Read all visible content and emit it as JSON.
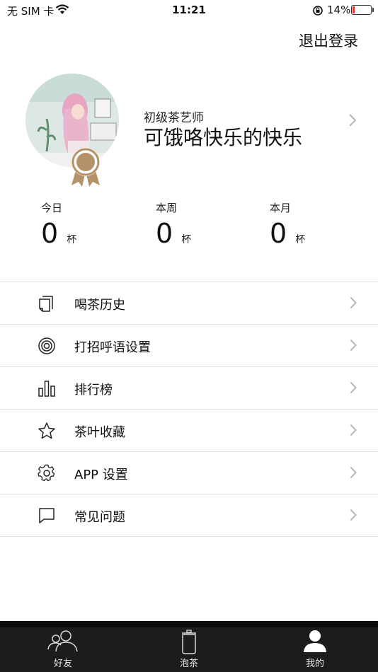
{
  "status_bar": {
    "carrier": "无 SIM 卡",
    "time": "11:21",
    "battery_percent": "14%",
    "battery_level": 0.14,
    "battery_color": "#e8322f"
  },
  "header": {
    "logout_label": "退出登录"
  },
  "profile": {
    "level": "初级茶艺师",
    "nickname": "可饿咯快乐的快乐",
    "medal_color": "#b4926a"
  },
  "stats": [
    {
      "label": "今日",
      "value": "0",
      "unit": "杯"
    },
    {
      "label": "本周",
      "value": "0",
      "unit": "杯"
    },
    {
      "label": "本月",
      "value": "0",
      "unit": "杯"
    }
  ],
  "menu": [
    {
      "label": "喝茶历史",
      "icon": "history-icon"
    },
    {
      "label": "打招呼语设置",
      "icon": "greeting-icon"
    },
    {
      "label": "排行榜",
      "icon": "ranking-icon"
    },
    {
      "label": "茶叶收藏",
      "icon": "star-icon"
    },
    {
      "label": "APP 设置",
      "icon": "gear-icon"
    },
    {
      "label": "常见问题",
      "icon": "chat-bubble-icon"
    }
  ],
  "tabbar": {
    "tabs": [
      {
        "label": "好友",
        "icon": "friends-icon"
      },
      {
        "label": "泡茶",
        "icon": "teapot-icon"
      },
      {
        "label": "我的",
        "icon": "user-icon"
      }
    ],
    "active_index": 2
  }
}
